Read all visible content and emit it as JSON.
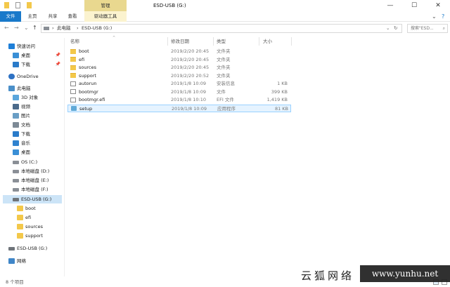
{
  "titlebar": {
    "context_tab": "管理",
    "window_title": "ESD-USB (G:)",
    "minimize": "—",
    "maximize": "☐",
    "close": "✕"
  },
  "ribbon": {
    "tabs": [
      "文件",
      "主页",
      "共享",
      "查看",
      "驱动器工具"
    ],
    "collapse": "⌄",
    "help": "?"
  },
  "navigation": {
    "back": "←",
    "forward": "→",
    "history": "⌄",
    "up": "↑",
    "separator": "›",
    "breadcrumb": [
      "此电脑",
      "ESD-USB (G:)"
    ],
    "dropdown": "⌄",
    "refresh": "↻",
    "search_placeholder": "搜索\"ESD...",
    "search_icon": "⌕"
  },
  "sidebar": {
    "items": [
      {
        "label": "快速访问",
        "icon": "star-icon",
        "color": "#1e7fd8"
      },
      {
        "label": "桌面",
        "icon": "desktop-icon",
        "color": "#3a8fd6",
        "pinned": true
      },
      {
        "label": "下载",
        "icon": "download-icon",
        "color": "#2a7bc9",
        "pinned": true
      },
      {
        "label": "OneDrive",
        "icon": "cloud-icon",
        "color": "#2e72c4"
      },
      {
        "label": "此电脑",
        "icon": "computer-icon",
        "color": "#4a8fc9"
      },
      {
        "label": "3D 对象",
        "icon": "cube-icon",
        "color": "#5aa6dc"
      },
      {
        "label": "视频",
        "icon": "video-icon",
        "color": "#4b6a8a"
      },
      {
        "label": "图片",
        "icon": "picture-icon",
        "color": "#6a9ec5"
      },
      {
        "label": "文档",
        "icon": "document-icon",
        "color": "#7d8a96"
      },
      {
        "label": "下载",
        "icon": "download-icon",
        "color": "#2a7bc9"
      },
      {
        "label": "音乐",
        "icon": "music-icon",
        "color": "#2f82cf"
      },
      {
        "label": "桌面",
        "icon": "desktop-icon",
        "color": "#3a8fd6"
      },
      {
        "label": "OS (C:)",
        "icon": "drive-icon",
        "color": "#8a8f96"
      },
      {
        "label": "本地磁盘 (D:)",
        "icon": "drive-icon",
        "color": "#8a8f96"
      },
      {
        "label": "本地磁盘 (E:)",
        "icon": "drive-icon",
        "color": "#8a8f96"
      },
      {
        "label": "本地磁盘 (F:)",
        "icon": "drive-icon",
        "color": "#8a8f96"
      },
      {
        "label": "ESD-USB (G:)",
        "icon": "usb-drive-icon",
        "color": "#6f747a",
        "selected": true
      },
      {
        "label": "boot",
        "icon": "folder-icon",
        "color": "#f3c84a"
      },
      {
        "label": "efi",
        "icon": "folder-icon",
        "color": "#f3c84a"
      },
      {
        "label": "sources",
        "icon": "folder-icon",
        "color": "#f3c84a"
      },
      {
        "label": "support",
        "icon": "folder-icon",
        "color": "#f3c84a"
      },
      {
        "label": "ESD-USB (G:)",
        "icon": "usb-drive-icon",
        "color": "#6f747a"
      },
      {
        "label": "网络",
        "icon": "network-icon",
        "color": "#3f86c8"
      }
    ]
  },
  "filelist": {
    "columns": [
      "名称",
      "修改日期",
      "类型",
      "大小"
    ],
    "sort_indicator": "^",
    "rows": [
      {
        "name": "boot",
        "date": "2019/2/20 20:45",
        "type": "文件夹",
        "size": "",
        "icon": "folder-icon"
      },
      {
        "name": "efi",
        "date": "2019/2/20 20:45",
        "type": "文件夹",
        "size": "",
        "icon": "folder-icon"
      },
      {
        "name": "sources",
        "date": "2019/2/20 20:45",
        "type": "文件夹",
        "size": "",
        "icon": "folder-icon"
      },
      {
        "name": "support",
        "date": "2019/2/20 20:52",
        "type": "文件夹",
        "size": "",
        "icon": "folder-icon"
      },
      {
        "name": "autorun",
        "date": "2019/1/8 10:09",
        "type": "安装信息",
        "size": "1 KB",
        "icon": "file-icon"
      },
      {
        "name": "bootmgr",
        "date": "2019/1/8 10:09",
        "type": "文件",
        "size": "399 KB",
        "icon": "file-icon"
      },
      {
        "name": "bootmgr.efi",
        "date": "2019/1/8 10:10",
        "type": "EFI 文件",
        "size": "1,419 KB",
        "icon": "file-icon"
      },
      {
        "name": "setup",
        "date": "2019/1/8 10:09",
        "type": "应用程序",
        "size": "81 KB",
        "icon": "setup-app-icon",
        "selected": true
      }
    ]
  },
  "status": {
    "count": "8 个项目"
  },
  "watermark": {
    "chinese": "云狐网络",
    "url": "www.yunhu.net"
  }
}
